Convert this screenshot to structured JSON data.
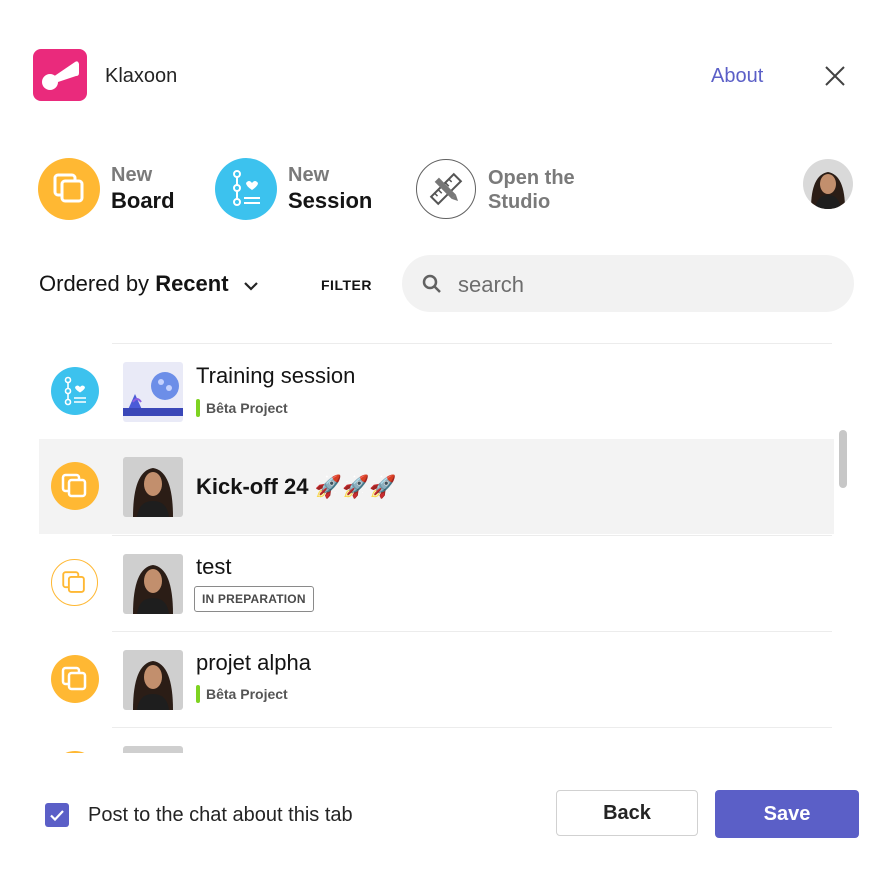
{
  "app": {
    "name": "Klaxoon",
    "about_label": "About"
  },
  "actions": {
    "new_board": {
      "line1": "New",
      "line2": "Board"
    },
    "new_session": {
      "line1": "New",
      "line2": "Session"
    },
    "open_studio": {
      "line1": "Open the",
      "line2": "Studio"
    }
  },
  "toolbar": {
    "order_prefix": "Ordered by",
    "order_value": "Recent",
    "filter_label": "FILTER",
    "search_placeholder": "search"
  },
  "list": {
    "items": [
      {
        "type": "session",
        "title": "Training session",
        "tag": "Bêta Project"
      },
      {
        "type": "board",
        "title": "Kick-off 24 🚀🚀🚀",
        "selected": true
      },
      {
        "type": "board-outline",
        "title": "test",
        "badge": "IN PREPARATION"
      },
      {
        "type": "board",
        "title": "projet alpha",
        "tag": "Bêta Project"
      }
    ]
  },
  "footer": {
    "post_to_chat_label": "Post to the chat about this tab",
    "post_to_chat_checked": true,
    "back_label": "Back",
    "save_label": "Save"
  },
  "colors": {
    "brand_pink": "#ea2a7c",
    "board_yellow": "#ffb833",
    "session_blue": "#3cc2ee",
    "teams_purple": "#5b5fc7",
    "tag_green": "#7ed321"
  },
  "icons": [
    "klaxoon-logo-icon",
    "close-icon",
    "board-icon",
    "session-icon",
    "studio-ruler-pencil-icon",
    "chevron-down-icon",
    "search-icon",
    "checkmark-icon"
  ]
}
